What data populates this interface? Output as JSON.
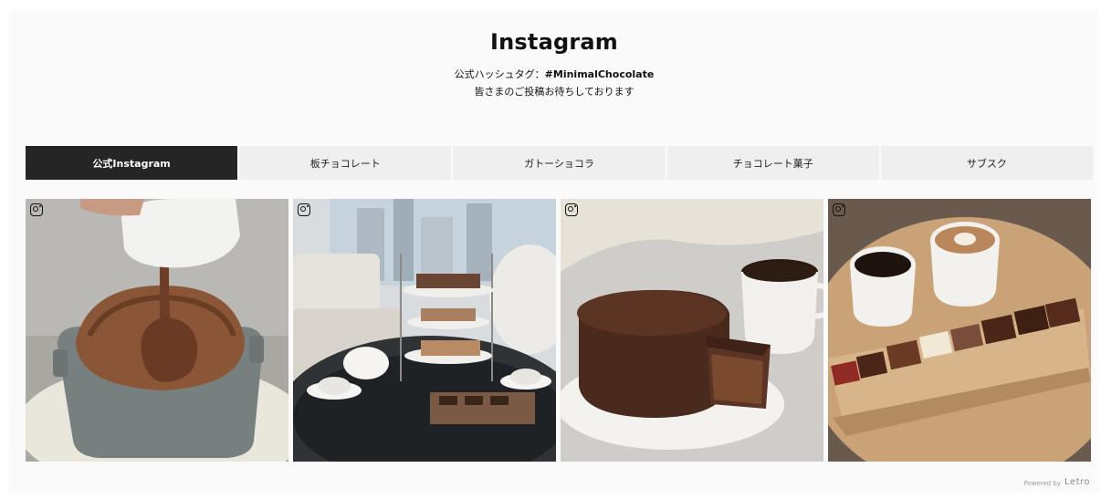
{
  "header": {
    "title": "Instagram",
    "subtitle_prefix": "公式ハッシュタグ：",
    "hashtag": "#MinimalChocolate",
    "subtitle_line2": "皆さまのご投稿お待ちしております"
  },
  "tabs": [
    {
      "label": "公式Instagram",
      "active": true
    },
    {
      "label": "板チョコレート",
      "active": false
    },
    {
      "label": "ガトーショコラ",
      "active": false
    },
    {
      "label": "チョコレート菓子",
      "active": false
    },
    {
      "label": "サブスク",
      "active": false
    }
  ],
  "posts": [
    {
      "description": "chocolate souffle with sauce poured",
      "icon": "instagram-icon"
    },
    {
      "description": "afternoon tea set with chocolate",
      "icon": "instagram-icon"
    },
    {
      "description": "chocolate gateau with coffee",
      "icon": "instagram-icon"
    },
    {
      "description": "chocolate bars on wooden board with coffee",
      "icon": "instagram-icon"
    }
  ],
  "footer": {
    "powered_by": "Powered by",
    "brand": "Letro"
  }
}
